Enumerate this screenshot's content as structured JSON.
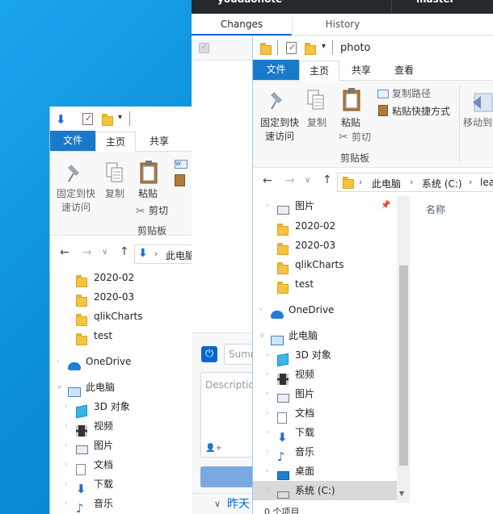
{
  "github": {
    "repo_name": "youdaonote",
    "branch_name": "master",
    "tabs": [
      {
        "label": "Changes",
        "active": true
      },
      {
        "label": "History",
        "active": false
      }
    ],
    "summary_placeholder": "Summ",
    "description_placeholder": "Description",
    "history_partial": "昨天"
  },
  "win1": {
    "ribbon_tabs": {
      "file": "文件",
      "home": "主页",
      "share": "共享"
    },
    "ribbon": {
      "pin": "固定到快速访问",
      "copy": "复制",
      "paste": "粘贴",
      "cut": "剪切",
      "group_clipboard": "剪贴板"
    },
    "address": {
      "this_pc": "此电脑"
    },
    "tree": [
      {
        "label": "2020-02",
        "icon": "folder"
      },
      {
        "label": "2020-03",
        "icon": "folder"
      },
      {
        "label": "qlikCharts",
        "icon": "folder"
      },
      {
        "label": "test",
        "icon": "folder"
      },
      {
        "label": "OneDrive",
        "icon": "cloud"
      },
      {
        "label": "此电脑",
        "icon": "computer"
      },
      {
        "label": "3D 对象",
        "icon": "cube"
      },
      {
        "label": "视频",
        "icon": "video"
      },
      {
        "label": "图片",
        "icon": "picture"
      },
      {
        "label": "文档",
        "icon": "document"
      },
      {
        "label": "下载",
        "icon": "download"
      },
      {
        "label": "音乐",
        "icon": "music"
      }
    ]
  },
  "win2": {
    "title": "photo",
    "ribbon_tabs": {
      "file": "文件",
      "home": "主页",
      "share": "共享",
      "view": "查看"
    },
    "ribbon": {
      "pin": "固定到快速访问",
      "copy": "复制",
      "paste": "粘贴",
      "copy_path": "复制路径",
      "paste_shortcut": "粘贴快捷方式",
      "cut": "剪切",
      "group_clipboard": "剪贴板",
      "move_to": "移动到"
    },
    "address": {
      "this_pc": "此电脑",
      "drive": "系统 (C:)",
      "tail": "lea"
    },
    "column_header": "名称",
    "tree": [
      {
        "label": "图片",
        "icon": "picture",
        "pinned": true
      },
      {
        "label": "2020-02",
        "icon": "folder"
      },
      {
        "label": "2020-03",
        "icon": "folder"
      },
      {
        "label": "qlikCharts",
        "icon": "folder"
      },
      {
        "label": "test",
        "icon": "folder"
      },
      {
        "label": "OneDrive",
        "icon": "cloud"
      },
      {
        "label": "此电脑",
        "icon": "computer"
      },
      {
        "label": "3D 对象",
        "icon": "cube"
      },
      {
        "label": "视频",
        "icon": "video"
      },
      {
        "label": "图片",
        "icon": "picture"
      },
      {
        "label": "文档",
        "icon": "document"
      },
      {
        "label": "下载",
        "icon": "download"
      },
      {
        "label": "音乐",
        "icon": "music"
      },
      {
        "label": "桌面",
        "icon": "desktop"
      },
      {
        "label": "系统 (C:)",
        "icon": "drive",
        "selected": true
      }
    ],
    "status_text": "0 个项目"
  },
  "colors": {
    "desktop_blue": "#0f8fd9",
    "ribbon_file_blue": "#1979ca",
    "github_dark": "#24292e",
    "selection_gray": "#cce8ff"
  }
}
